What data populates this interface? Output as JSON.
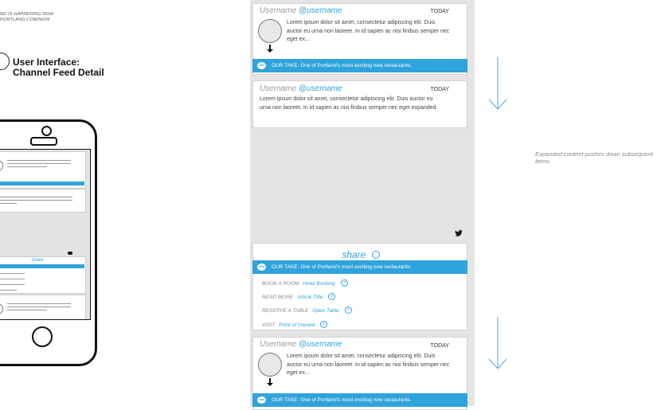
{
  "left_panel": {
    "tagline_line1": "ND IS HAPPENING NOW",
    "tagline_line2": "PORTLAND.COM/NOW",
    "section_title_line1": "User Interface:",
    "section_title_line2": "Channel Feed Detail"
  },
  "mini_screen": {
    "share_label": "share"
  },
  "feed": {
    "cards": [
      {
        "username": "Username",
        "handle": "@username",
        "date": "TODAY",
        "body": "Lorem ipsum dolor sit amet, consectetur adipiscing elit. Duis auctor eu urna non laoreet. In id sapien ac nisi finibus semper nec eget ex...",
        "take_badge": "rate",
        "take_text": "OUR TAKE: One of Portland's most exciting new restaurants."
      },
      {
        "username": "Username",
        "handle": "@username",
        "date": "TODAY",
        "body": "Lorem ipsum dolor sit amet, consectetur adipiscing elit. Duis auctor eu urna non laoreet. In id sapien ac nisi finibus semper nec eget expanded."
      },
      {
        "username": "Username",
        "handle": "@username",
        "date": "TODAY",
        "body": "Lorem ipsum dolor sit amet, consectetur adipiscing elit. Duis auctor eu urna non laoreet. In id sapien ac nisi finibus semper nec eget ex...",
        "take_badge": "rate",
        "take_text": "OUR TAKE: One of Portland's most exciting new restaurants."
      }
    ],
    "share": {
      "label": "share",
      "take_badge": "rate",
      "take_text": "OUR TAKE: One of Portland's most exciting new restaurants.",
      "actions": [
        {
          "prefix": "BOOK A ROOM",
          "link": "Hotel Booking"
        },
        {
          "prefix": "READ MORE",
          "link": "Article Title"
        },
        {
          "prefix": "RESERVE A TABLE",
          "link": "Open Table"
        },
        {
          "prefix": "VISIT",
          "link": "Point of Interest"
        }
      ]
    }
  },
  "annotation": {
    "note": "Expanded content pushes down subsequent items."
  },
  "colors": {
    "accent": "#2fa3dc",
    "feed_background": "#e4e4e4",
    "arrow": "#4aa8e0"
  },
  "icons": [
    "pin-icon",
    "twitter-icon",
    "share-icon",
    "external-link-icon",
    "down-arrow-icon"
  ]
}
